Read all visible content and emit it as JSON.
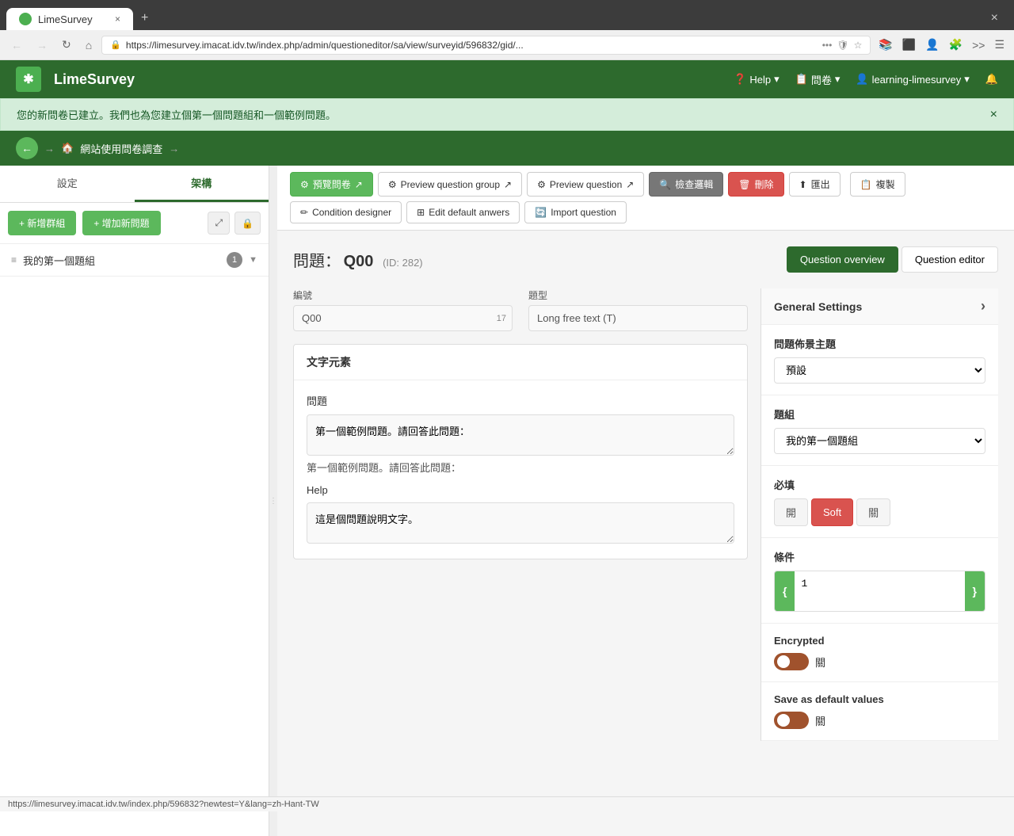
{
  "browser": {
    "tab_title": "LimeSurvey",
    "tab_close": "×",
    "new_tab": "+",
    "close_window": "×",
    "url": "https://limesurvey.imacat.idv.tw/index.php/admin/questioneditor/sa/view/surveyid/596832/gid/...",
    "nav_back": "←",
    "nav_forward": "→",
    "nav_refresh": "↻",
    "nav_home": "⌂"
  },
  "app": {
    "logo": "LimeSurvey",
    "header_help": "Help",
    "header_survey": "問卷",
    "header_user": "learning-limesurvey",
    "header_bell": "🔔"
  },
  "notification": {
    "message": "您的新問卷已建立。我們也為您建立個第一個問題組和一個範例問題。",
    "close": "×"
  },
  "breadcrumb": {
    "items": [
      "🏠",
      "網站使用問卷調查",
      "→"
    ]
  },
  "sidebar": {
    "tab_settings": "設定",
    "tab_structure": "架構",
    "btn_new_group": "+ 新增群組",
    "btn_add_question": "+ 增加新問題",
    "icon_expand": "⤢",
    "icon_lock": "🔒",
    "group_icon": "≡",
    "group_label": "我的第一個題組",
    "group_badge": "1",
    "group_expand": "▼"
  },
  "toolbar": {
    "preview_survey": "預覽問卷",
    "preview_question_group": "Preview question group",
    "preview_question": "Preview question",
    "check_logic": "檢查邏輯",
    "delete": "刪除",
    "export": "匯出",
    "copy": "複製",
    "condition_designer": "Condition designer",
    "edit_default_answers": "Edit default anwers",
    "import_question": "Import question"
  },
  "question": {
    "prefix": "問題：",
    "code": "Q00",
    "id_label": "(ID: 282)",
    "tab_overview": "Question overview",
    "tab_editor": "Question editor",
    "field_code_label": "編號",
    "field_code_value": "Q00",
    "field_code_count": "17",
    "field_type_label": "題型",
    "field_type_value": "Long free text (T)",
    "panel_title": "文字元素",
    "question_label": "問題",
    "question_value": "第一個範例問題。請回答此問題：",
    "help_label": "Help",
    "help_value": "這是個問題說明文字。"
  },
  "settings": {
    "header": "General Settings",
    "expand_icon": "›",
    "theme_label": "問題佈景主題",
    "theme_value": "預設",
    "group_label": "題組",
    "group_value": "我的第一個題組",
    "mandatory_label": "必填",
    "mandatory_on": "開",
    "mandatory_soft": "Soft",
    "mandatory_off": "關",
    "condition_label": "條件",
    "condition_open_brace": "{",
    "condition_value": "1",
    "condition_close_brace": "}",
    "encrypted_label": "Encrypted",
    "encrypted_toggle_label": "關",
    "save_default_label": "Save as default values",
    "save_default_toggle_label": "關"
  },
  "status_bar": {
    "url": "https://limesurvey.imacat.idv.tw/index.php/596832?newtest=Y&lang=zh-Hant-TW"
  }
}
